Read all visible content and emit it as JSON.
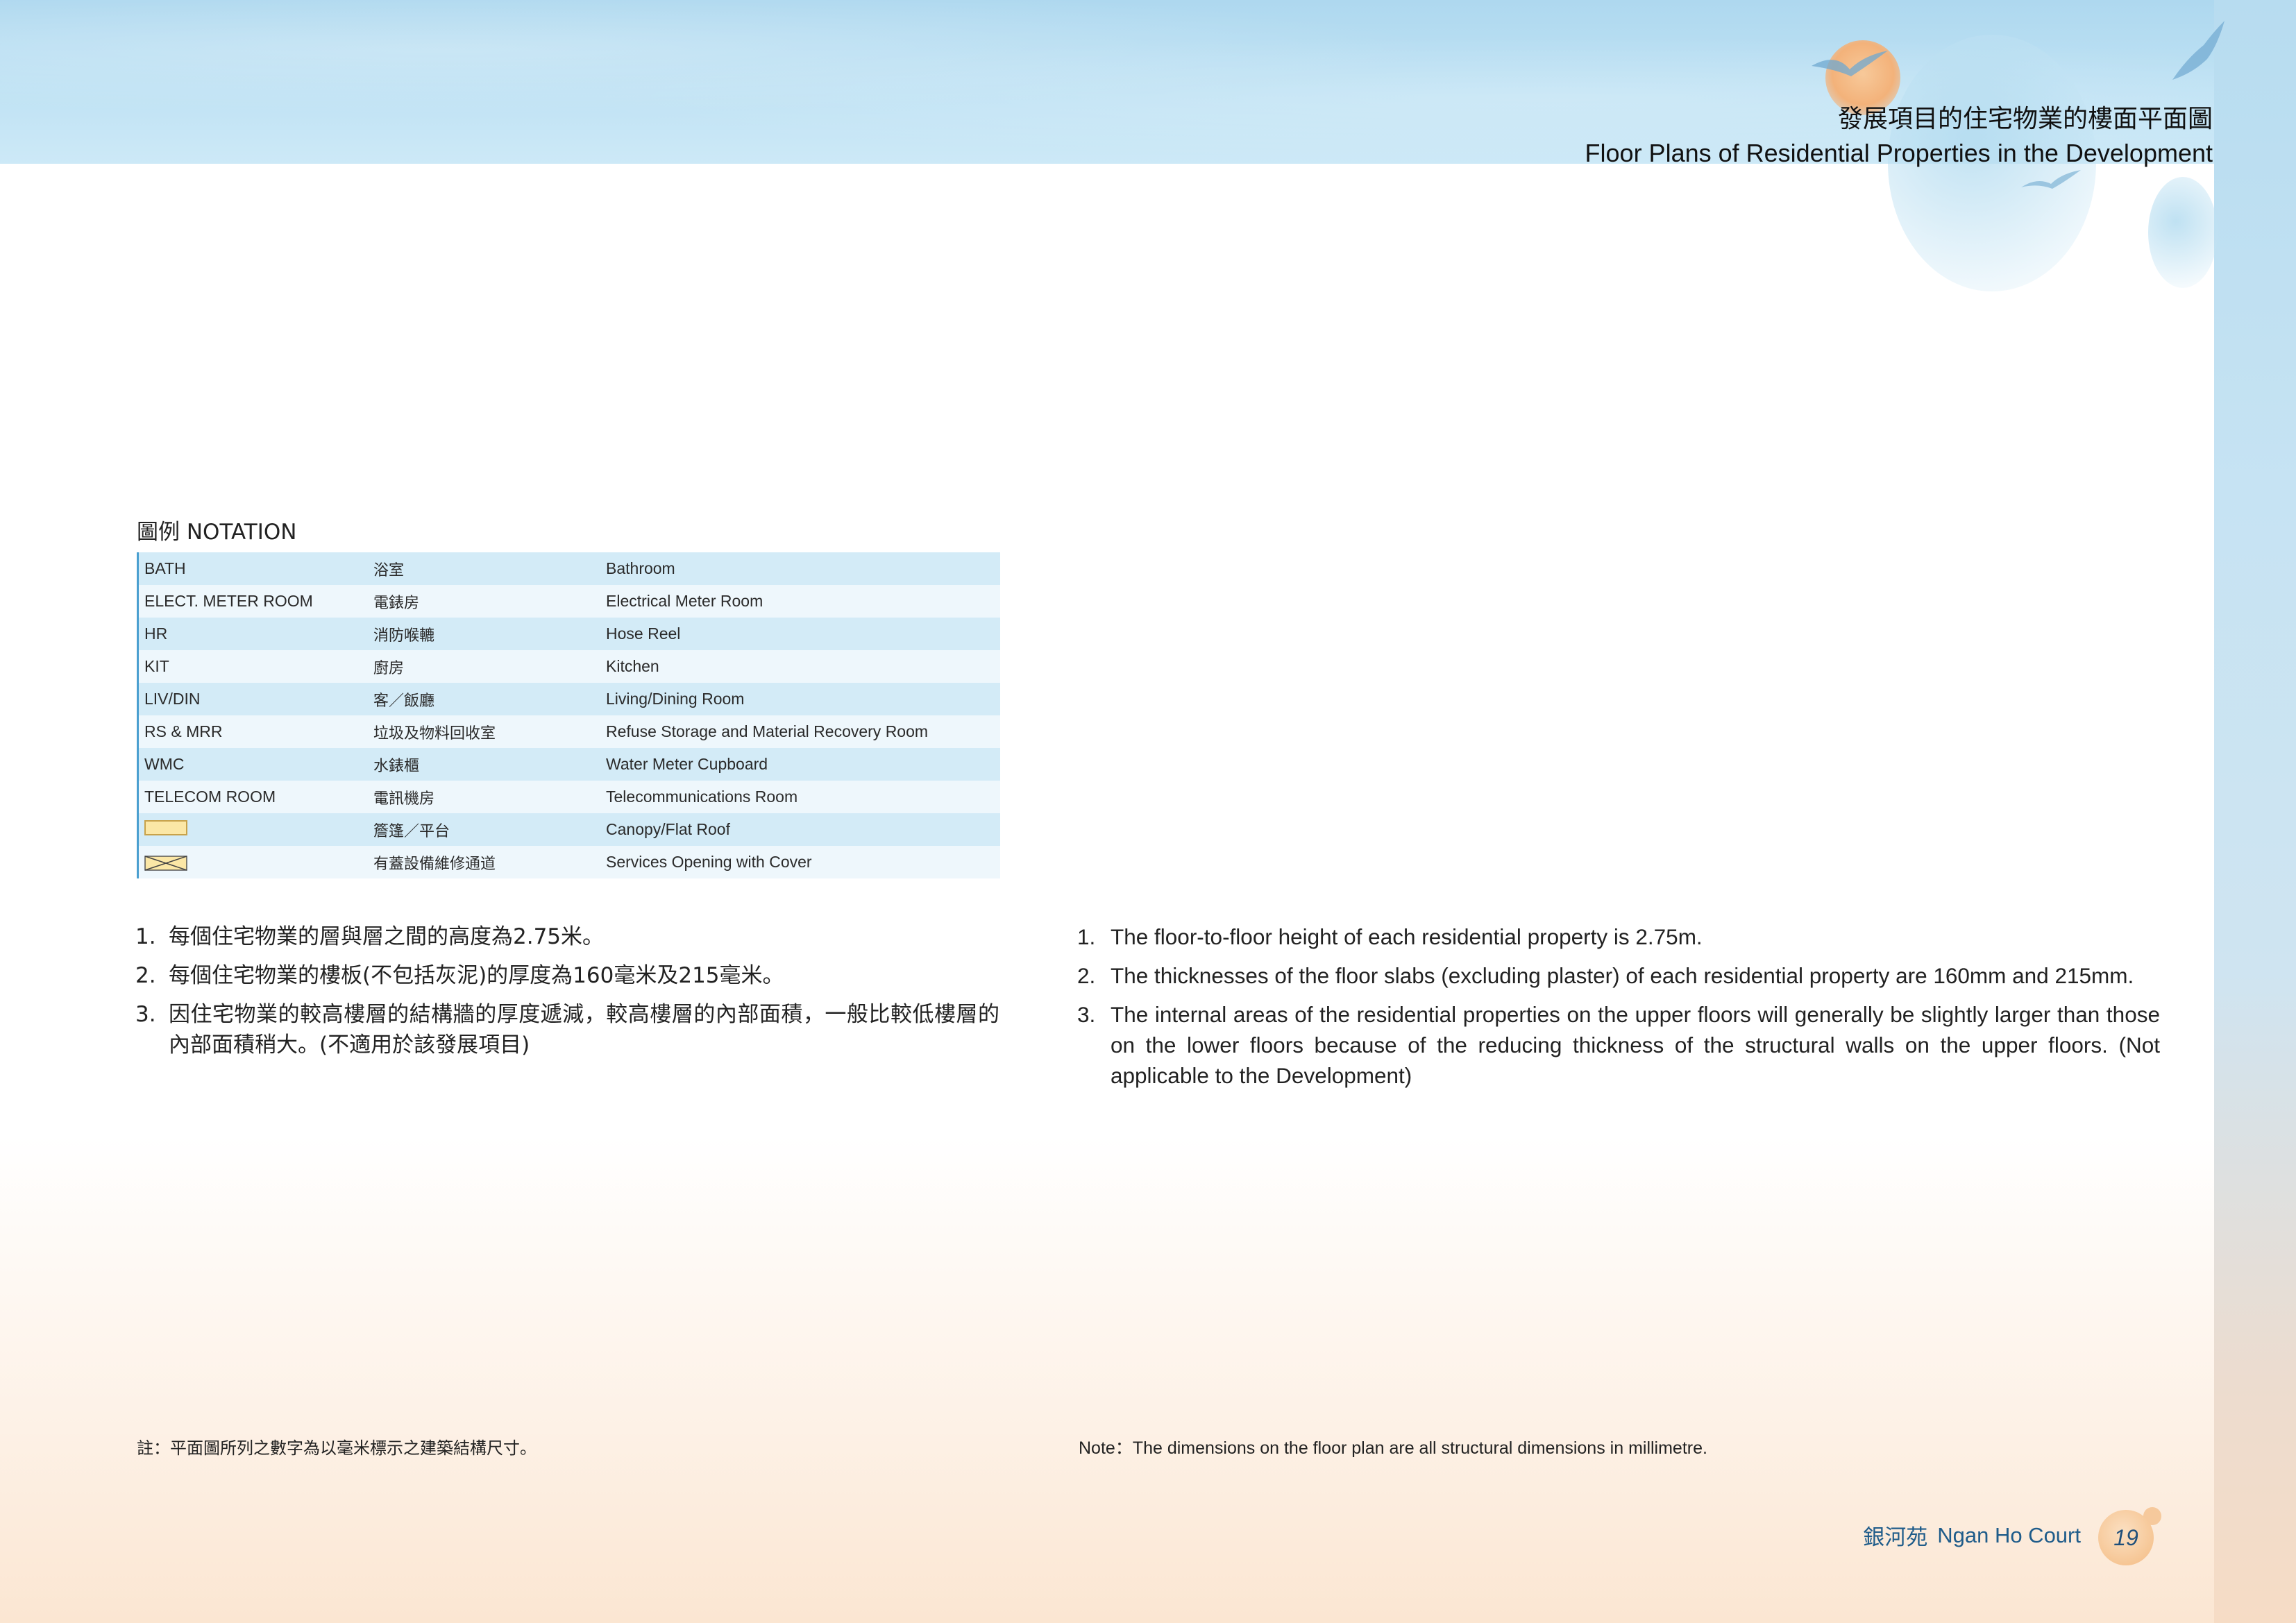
{
  "header": {
    "title_zh": "發展項目的住宅物業的樓面平面圖",
    "title_en": "Floor Plans of Residential Properties in the Development"
  },
  "notation": {
    "heading": "圖例 NOTATION",
    "rows": [
      {
        "abbr": "BATH",
        "zh": "浴室",
        "en": "Bathroom"
      },
      {
        "abbr": "ELECT. METER ROOM",
        "zh": "電錶房",
        "en": "Electrical Meter Room"
      },
      {
        "abbr": "HR",
        "zh": "消防喉轆",
        "en": "Hose Reel"
      },
      {
        "abbr": "KIT",
        "zh": "廚房",
        "en": "Kitchen"
      },
      {
        "abbr": "LIV/DIN",
        "zh": "客／飯廳",
        "en": "Living/Dining Room"
      },
      {
        "abbr": "RS & MRR",
        "zh": "垃圾及物料回收室",
        "en": "Refuse Storage and Material Recovery Room"
      },
      {
        "abbr": "WMC",
        "zh": "水錶櫃",
        "en": "Water Meter Cupboard"
      },
      {
        "abbr": "TELECOM ROOM",
        "zh": "電訊機房",
        "en": "Telecommunications Room"
      },
      {
        "abbr": "",
        "zh": "簷篷／平台",
        "en": "Canopy/Flat Roof"
      },
      {
        "abbr": "",
        "zh": "有蓋設備維修通道",
        "en": "Services Opening with Cover"
      }
    ]
  },
  "notes_zh": [
    {
      "num": "1.",
      "text": "每個住宅物業的層與層之間的高度為2.75米。"
    },
    {
      "num": "2.",
      "text": "每個住宅物業的樓板(不包括灰泥)的厚度為160毫米及215毫米。"
    },
    {
      "num": "3.",
      "text": "因住宅物業的較高樓層的結構牆的厚度遞減，較高樓層的內部面積，一般比較低樓層的內部面積稍大。(不適用於該發展項目)"
    }
  ],
  "notes_en": [
    {
      "num": "1.",
      "text": "The floor-to-floor height of each residential property is 2.75m."
    },
    {
      "num": "2.",
      "text": "The thicknesses of the floor slabs (excluding plaster) of each residential property are 160mm and 215mm."
    },
    {
      "num": "3.",
      "text": "The internal areas of the residential properties on the upper floors will generally be slightly larger than those on the lower floors because of the reducing thickness of the structural walls on the upper floors. (Not applicable to the Development)"
    }
  ],
  "footnote_zh": "註：平面圖所列之數字為以毫米標示之建築結構尺寸。",
  "footnote_en": "Note：The dimensions on the floor plan are all structural dimensions in millimetre.",
  "footer": {
    "name_zh": "銀河苑",
    "name_en": "Ngan Ho Court",
    "page": "19"
  },
  "colors": {
    "accent_blue": "#4a9fd0",
    "row_odd": "#d3ebf7",
    "row_even": "#eef7fc",
    "footer_text": "#1f5c8a",
    "canopy_fill": "#fbe7a6"
  },
  "icons": {
    "canopy_symbol": "canopy-flat-roof-icon",
    "cover_symbol": "services-opening-cover-icon"
  }
}
